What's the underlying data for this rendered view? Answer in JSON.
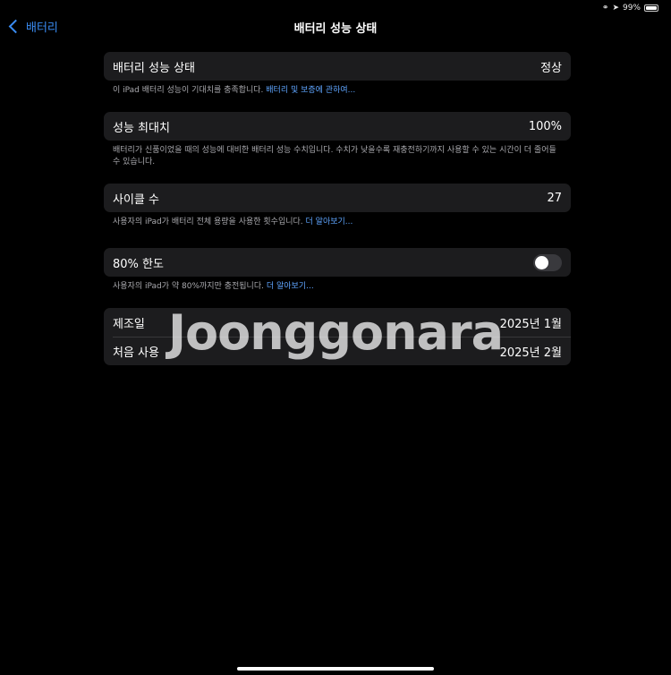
{
  "status": {
    "battery_percent": "99%"
  },
  "nav": {
    "back_label": "배터리",
    "title": "배터리 성능 상태"
  },
  "sections": {
    "health": {
      "label": "배터리 성능 상태",
      "value": "정상",
      "note": "이 iPad 배터리 성능이 기대치를 충족합니다. ",
      "link": "배터리 및 보증에 관하여..."
    },
    "max_capacity": {
      "label": "성능 최대치",
      "value": "100%",
      "note": "배터리가 신품이었을 때의 성능에 대비한 배터리 성능 수치입니다. 수치가 낮을수록 재충전하기까지 사용할 수 있는 시간이 더 줄어들 수 있습니다."
    },
    "cycle_count": {
      "label": "사이클 수",
      "value": "27",
      "note": "사용자의 iPad가 배터리 전체 용량을 사용한 횟수입니다. ",
      "link": "더 알아보기..."
    },
    "limit": {
      "label": "80% 한도",
      "toggle_on": false,
      "note": "사용자의 iPad가 약 80%까지만 충전됩니다. ",
      "link": "더 알아보기..."
    },
    "dates": {
      "manufactured_label": "제조일",
      "manufactured_value": "2025년 1월",
      "first_use_label": "처음 사용",
      "first_use_value": "2025년 2월"
    }
  },
  "watermark": {
    "text": "Joonggonara"
  },
  "colors": {
    "background": "#000000",
    "cell": "#1c1c1e",
    "accent": "#3a8cf3",
    "footnote": "#a9a9ae"
  }
}
